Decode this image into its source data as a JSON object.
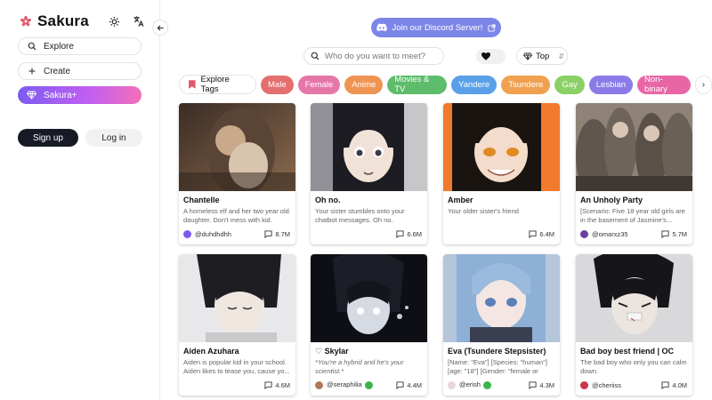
{
  "brand": {
    "name": "Sakura",
    "accent": "#e05a6d"
  },
  "sidebar": {
    "explore_label": "Explore",
    "create_label": "Create",
    "plus_label": "Sakura+",
    "signup_label": "Sign up",
    "login_label": "Log in"
  },
  "header": {
    "discord_label": "Join our Discord Server!",
    "search_placeholder": "Who do you want to meet?",
    "sort_label": "Top"
  },
  "tags": {
    "explore_label": "Explore Tags",
    "items": [
      {
        "label": "Male",
        "color": "#e56f6f"
      },
      {
        "label": "Female",
        "color": "#e776a8"
      },
      {
        "label": "Anime",
        "color": "#ef9554"
      },
      {
        "label": "Movies & TV",
        "color": "#5dbd6b"
      },
      {
        "label": "Yandere",
        "color": "#5aa0e8"
      },
      {
        "label": "Tsundere",
        "color": "#f0a04f"
      },
      {
        "label": "Gay",
        "color": "#8bd066"
      },
      {
        "label": "Lesbian",
        "color": "#8a7be8"
      },
      {
        "label": "Non-binary",
        "color": "#e866a6"
      }
    ]
  },
  "cards": [
    {
      "title": "Chantelle",
      "desc": "A homeless elf and her two year old daughter. Don't mess with kid.",
      "creator": "@duhdhdhh",
      "chats": "8.7M",
      "verified": false
    },
    {
      "title": "Oh no.",
      "desc": "Your sister stumbles onto your chatbot messages. Oh no.",
      "creator": "",
      "chats": "6.6M",
      "verified": false
    },
    {
      "title": "Amber",
      "desc": "Your older sister's friend",
      "creator": "",
      "chats": "6.4M",
      "verified": false
    },
    {
      "title": "An Unholy Party",
      "desc": "[Scenario: Five 18 year old girls are in the basement of Jasmine's...",
      "creator": "@omarxz35",
      "chats": "5.7M",
      "verified": false
    },
    {
      "title": "Aiden Azuhara",
      "desc": "Aiden is popular kid in your school. Aiden likes to tease you, cause yo...",
      "creator": "",
      "chats": "4.6M",
      "verified": false
    },
    {
      "title": "♡ Skylar",
      "desc": "*You're a hybrid and he's your scientist.*",
      "creator": "@seraphilia",
      "chats": "4.4M",
      "verified": true
    },
    {
      "title": "Eva (Tsundere Stepsister)",
      "desc": "[Name: \"Eva\"] [Species: \"human\"] [age: \"18\"] [Gender: \"female or her\"...",
      "creator": "@erish",
      "chats": "4.3M",
      "verified": true
    },
    {
      "title": "Bad boy best friend | OC",
      "desc": "The bad boy who only you can calm down.",
      "creator": "@cheriiss",
      "chats": "4.0M",
      "verified": false
    }
  ]
}
